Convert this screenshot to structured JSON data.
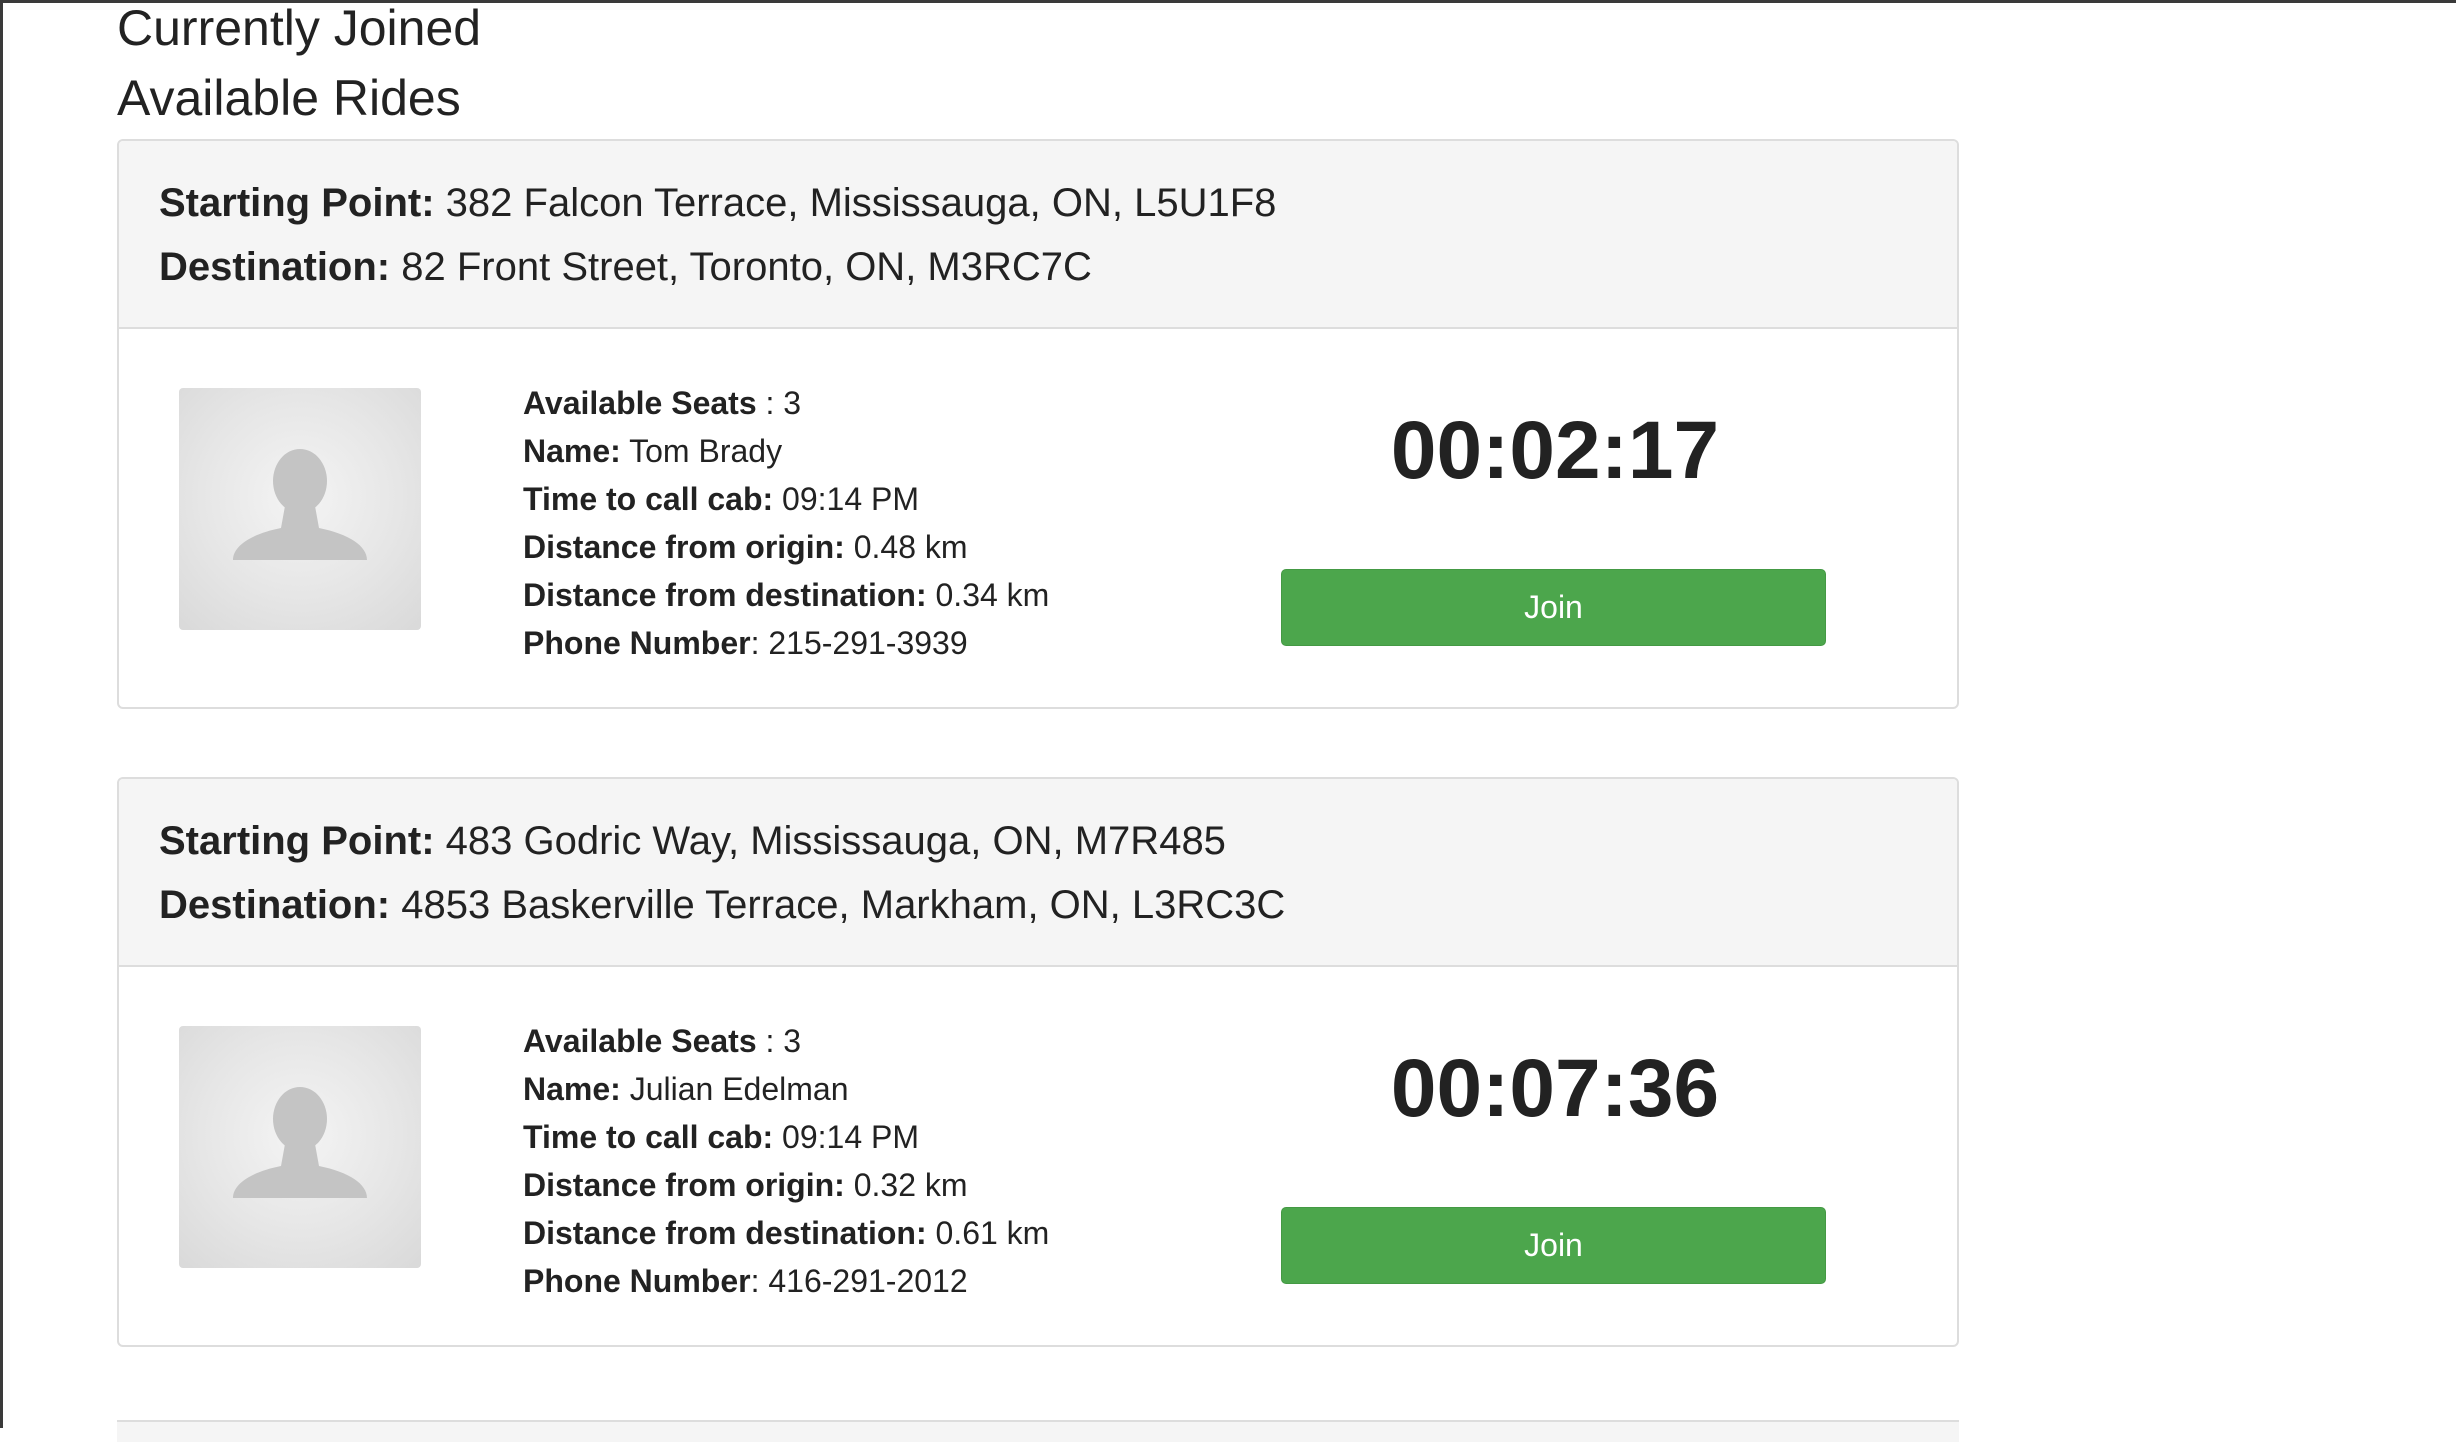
{
  "sections": {
    "joined_title": "Currently Joined",
    "available_title": "Available Rides"
  },
  "rides": [
    {
      "start_label": "Starting Point:",
      "start": "382 Falcon Terrace, Mississauga, ON, L5U1F8",
      "dest_label": "Destination:",
      "dest": "82 Front Street, Toronto, ON, M3RC7C",
      "seats_label": "Available Seats",
      "seats": " : 3",
      "name_label": "Name:",
      "name": "Tom Brady",
      "time_label": "Time to call cab:",
      "time": "09:14 PM",
      "origin_label": "Distance from origin:",
      "origin_dist": "0.48 km",
      "destdist_label": "Distance from destination:",
      "dest_dist": "0.34 km",
      "phone_label": "Phone Number",
      "phone": ": 215-291-3939",
      "countdown": "00:02:17",
      "join_label": "Join"
    },
    {
      "start_label": "Starting Point:",
      "start": "483 Godric Way, Mississauga, ON, M7R485",
      "dest_label": "Destination:",
      "dest": "4853 Baskerville Terrace, Markham, ON, L3RC3C",
      "seats_label": "Available Seats",
      "seats": " : 3",
      "name_label": "Name:",
      "name": "Julian Edelman",
      "time_label": "Time to call cab:",
      "time": "09:14 PM",
      "origin_label": "Distance from origin:",
      "origin_dist": "0.32 km",
      "destdist_label": "Distance from destination:",
      "dest_dist": "0.61 km",
      "phone_label": "Phone Number",
      "phone": ": 416-291-2012",
      "countdown": "00:07:36",
      "join_label": "Join"
    }
  ],
  "colors": {
    "join_button": "#4ca64c",
    "card_header": "#f5f5f5",
    "border": "#dddddd"
  },
  "icons": {
    "avatar": "user-placeholder-icon"
  }
}
